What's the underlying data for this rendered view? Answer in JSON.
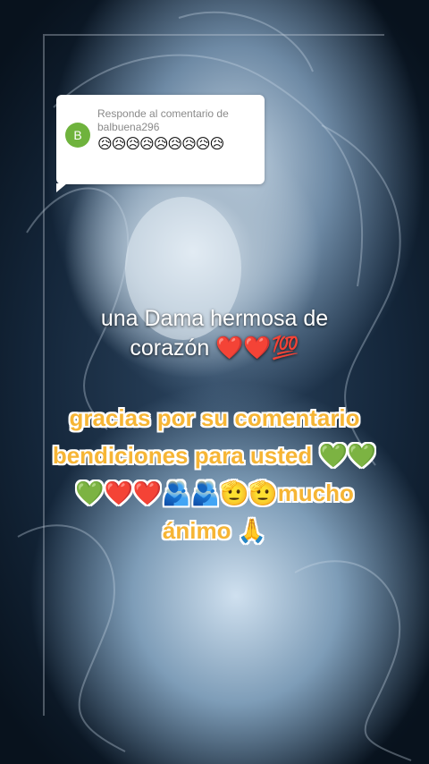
{
  "reply": {
    "avatar_letter": "B",
    "title": "Responde al comentario de balbuena296",
    "emojis": "😥😥😥😥😥😥😥😥😥"
  },
  "captions": {
    "line1": "una Dama hermosa de",
    "line2": "corazón ❤️❤️💯",
    "highlight1": "gracias por su comentario",
    "highlight2": "bendiciones para usted 💚💚",
    "highlight3": "💚❤️❤️🫂🫂🫡🫡mucho",
    "highlight4": "ánimo 🙏"
  },
  "colors": {
    "avatar": "#6fb33d",
    "highlight_text": "#f6b535"
  }
}
